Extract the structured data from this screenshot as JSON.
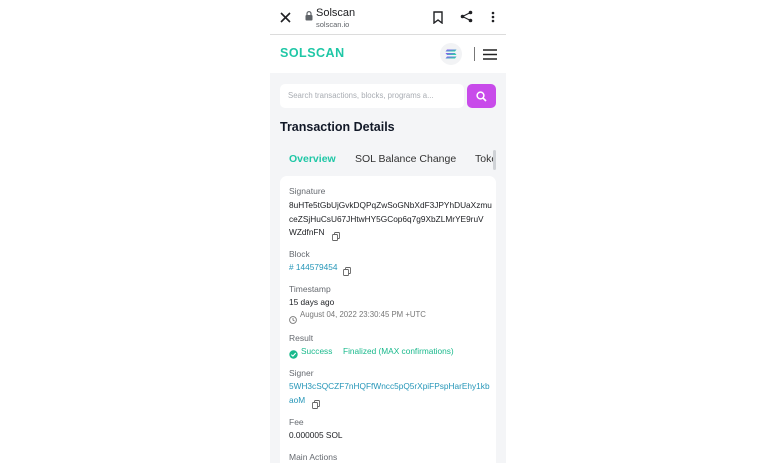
{
  "browser": {
    "title": "Solscan",
    "url": "solscan.io",
    "close_icon": "close-icon",
    "lock_icon": "lock-icon",
    "bookmark_icon": "bookmark-icon",
    "share_icon": "share-icon",
    "menu_icon": "more-vert-icon"
  },
  "header": {
    "logo": "SOLSCAN",
    "solana_icon": "solana-icon",
    "menu_icon": "hamburger-icon"
  },
  "search": {
    "placeholder": "Search transactions, blocks, programs a...",
    "button_icon": "search-icon"
  },
  "page": {
    "title": "Transaction Details"
  },
  "tabs": [
    {
      "label": "Overview",
      "active": true
    },
    {
      "label": "SOL Balance Change",
      "active": false
    },
    {
      "label": "Toke",
      "active": false
    }
  ],
  "details": {
    "signature_label": "Signature",
    "signature_lines": [
      "8uHTe5tGbUjGvkDQPqZwSoGNbXdF3JPYhDUaXzmu",
      "ceZSjHuCsU67JHtwHY5GCop6q7g9XbZLMrYE9ruV",
      "WZdfnFN"
    ],
    "block_label": "Block",
    "block_value": "# 144579454",
    "timestamp_label": "Timestamp",
    "timestamp_relative": "15 days ago",
    "timestamp_absolute": "August 04, 2022 23:30:45 PM +UTC",
    "result_label": "Result",
    "result_status": "Success",
    "result_detail": "Finalized (MAX confirmations)",
    "signer_label": "Signer",
    "signer_lines": [
      "5WH3cSQCZF7nHQFfWncc5pQ5rXpiFPspHarEhy1kb",
      "aoM"
    ],
    "fee_label": "Fee",
    "fee_value": "0.000005 SOL",
    "main_actions_label": "Main Actions"
  },
  "colors": {
    "brand": "#1fc7a6",
    "search_button": "#c84bea",
    "link": "#2596b8",
    "success": "#19b98c"
  }
}
